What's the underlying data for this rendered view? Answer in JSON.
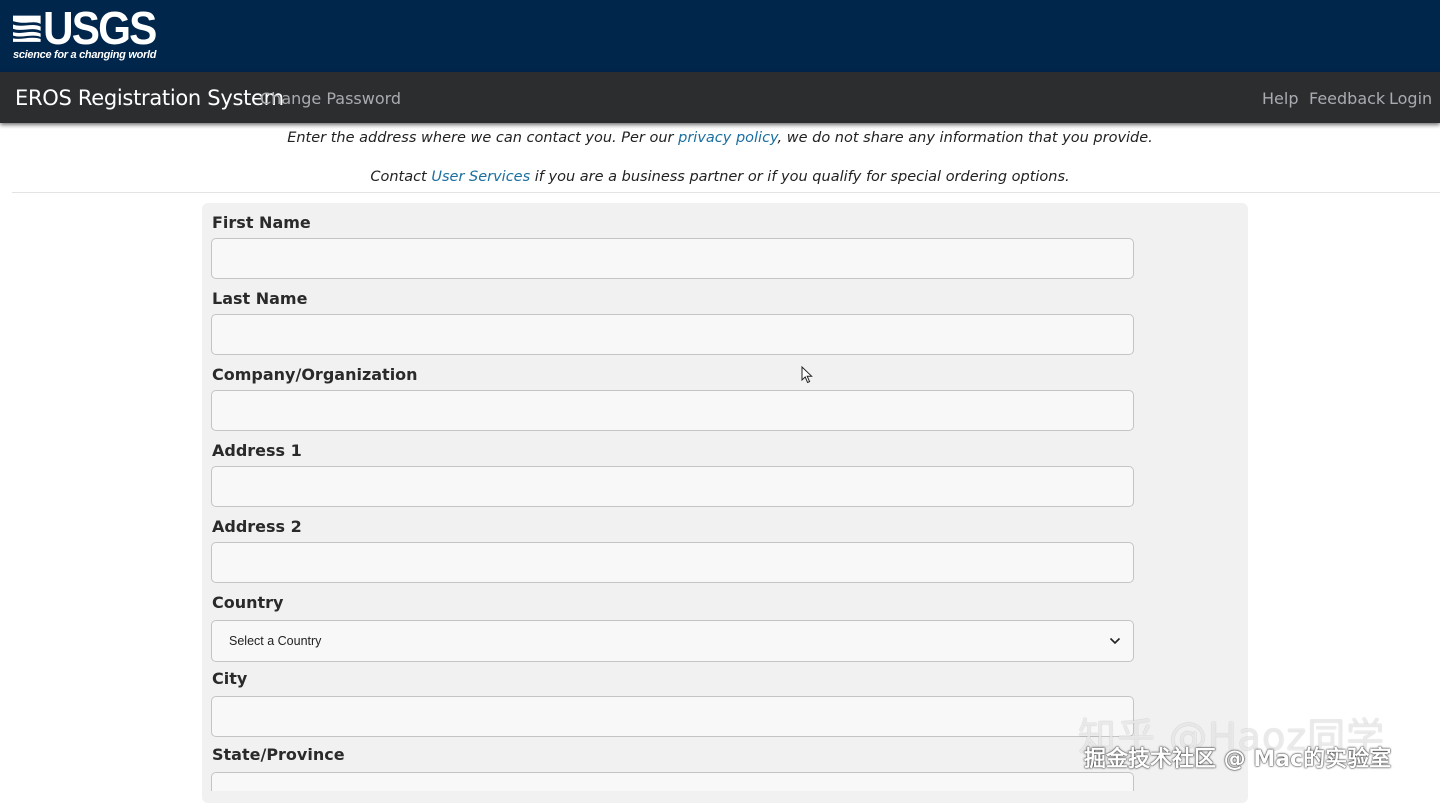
{
  "header": {
    "logo_text": "USGS",
    "logo_tagline": "science for a changing world"
  },
  "navbar": {
    "brand": "EROS Registration System",
    "change_password": "Change Password",
    "help": "Help",
    "feedback": "Feedback",
    "login": "Login"
  },
  "intro": {
    "line1_pre": "Enter the address where we can contact you. Per our ",
    "line1_link": "privacy policy",
    "line1_post": ", we do not share any information that you provide.",
    "line2_pre": "Contact ",
    "line2_link": "User Services",
    "line2_post": " if you are a business partner or if you qualify for special ordering options."
  },
  "form": {
    "first_name_label": "First Name",
    "first_name_value": "",
    "last_name_label": "Last Name",
    "last_name_value": "",
    "company_label": "Company/Organization",
    "company_value": "",
    "address1_label": "Address 1",
    "address1_value": "",
    "address2_label": "Address 2",
    "address2_value": "",
    "country_label": "Country",
    "country_selected": "Select a Country",
    "city_label": "City",
    "city_value": "",
    "state_label": "State/Province",
    "state_value": ""
  },
  "watermark": {
    "line1": "知乎 @Haoz同学",
    "line2": "掘金技术社区 @ Mac的实验室"
  }
}
